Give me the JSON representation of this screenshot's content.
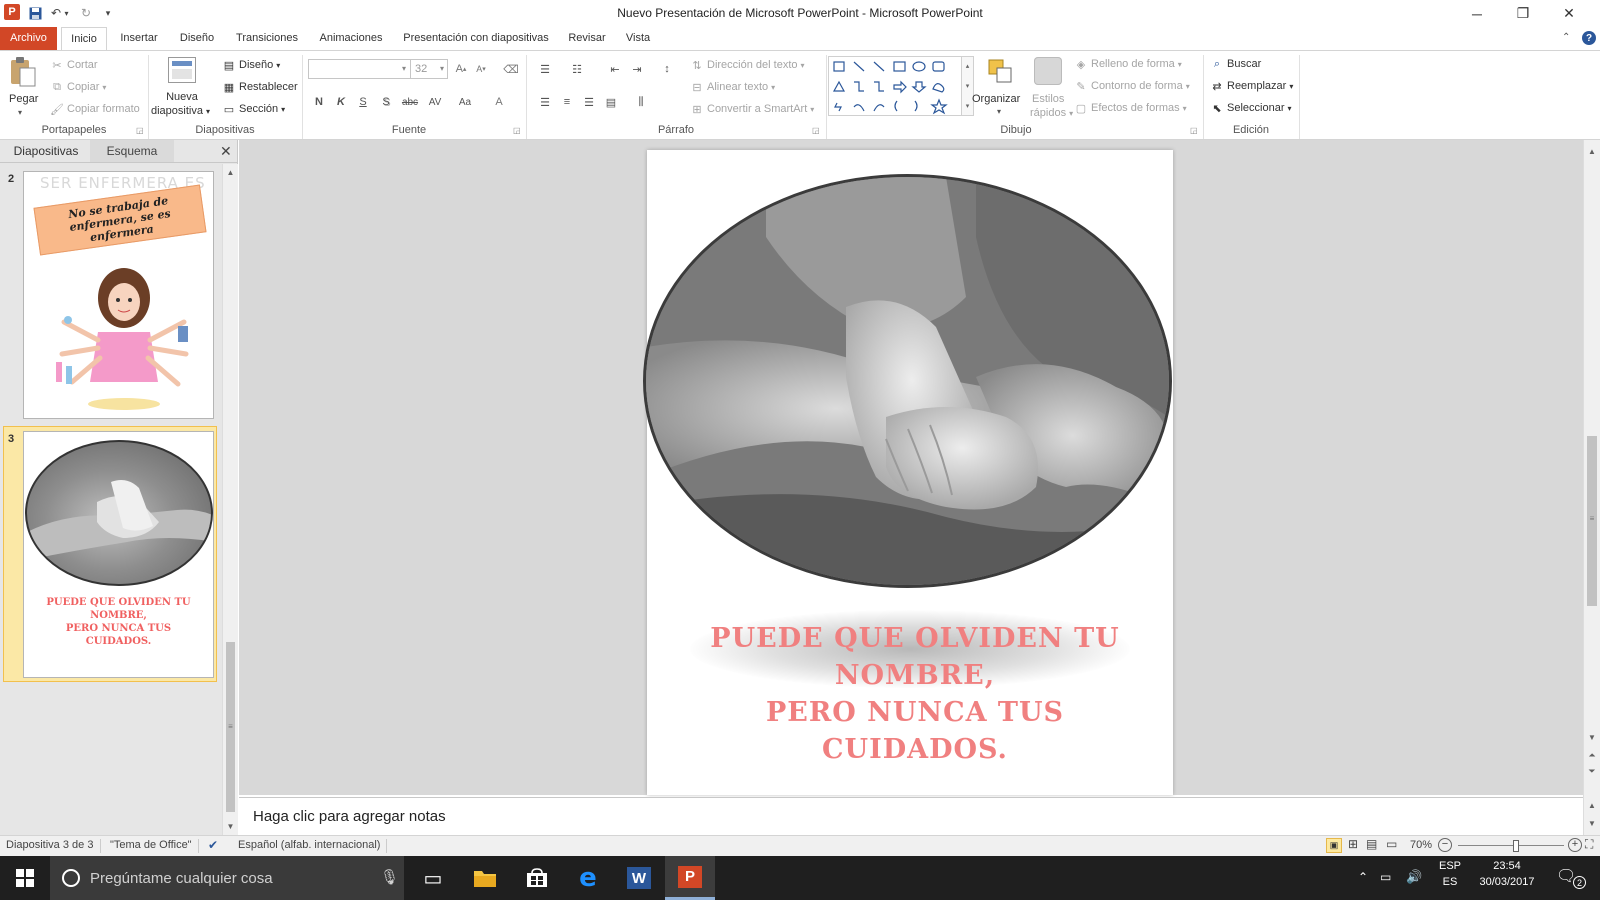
{
  "window": {
    "title": "Nuevo Presentación de Microsoft PowerPoint - Microsoft PowerPoint"
  },
  "tabs": [
    {
      "label": "Archivo"
    },
    {
      "label": "Inicio"
    },
    {
      "label": "Insertar"
    },
    {
      "label": "Diseño"
    },
    {
      "label": "Transiciones"
    },
    {
      "label": "Animaciones"
    },
    {
      "label": "Presentación con diapositivas"
    },
    {
      "label": "Revisar"
    },
    {
      "label": "Vista"
    }
  ],
  "ribbon": {
    "portapapeles": {
      "label": "Portapapeles",
      "pegar": "Pegar",
      "cortar": "Cortar",
      "copiar": "Copiar",
      "copiar_formato": "Copiar formato"
    },
    "diapositivas": {
      "label": "Diapositivas",
      "nueva_l1": "Nueva",
      "nueva_l2": "diapositiva",
      "diseno": "Diseño",
      "restablecer": "Restablecer",
      "seccion": "Sección"
    },
    "fuente": {
      "label": "Fuente",
      "size": "32",
      "bold": "N",
      "italic": "K",
      "underline": "S",
      "shadow": "S",
      "strike": "abc",
      "spacing": "AV",
      "case": "Aa",
      "color": "A"
    },
    "parrafo": {
      "label": "Párrafo",
      "direccion": "Dirección del texto",
      "alinear": "Alinear texto",
      "smartart": "Convertir a SmartArt"
    },
    "dibujo": {
      "label": "Dibujo",
      "organizar": "Organizar",
      "estilos_l1": "Estilos",
      "estilos_l2": "rápidos",
      "relleno": "Relleno de forma",
      "contorno": "Contorno de forma",
      "efectos": "Efectos de formas"
    },
    "edicion": {
      "label": "Edición",
      "buscar": "Buscar",
      "reemplazar": "Reemplazar",
      "seleccionar": "Seleccionar"
    }
  },
  "left_pane": {
    "tab_diapositivas": "Diapositivas",
    "tab_esquema": "Esquema",
    "thumbs": [
      {
        "number": "2",
        "header": "SER ENFERMERA ES",
        "banner": "No se trabaja de enfermera, se es enfermera"
      },
      {
        "number": "3",
        "caption_l1": "PUEDE QUE OLVIDEN TU",
        "caption_l2": "NOMBRE,",
        "caption_l3": "PERO NUNCA TUS",
        "caption_l4": "CUIDADOS."
      }
    ]
  },
  "slide": {
    "line1": "PUEDE QUE OLVIDEN TU",
    "line2": "NOMBRE,",
    "line3": "PERO NUNCA TUS",
    "line4": "CUIDADOS."
  },
  "notes": {
    "placeholder": "Haga clic para agregar notas"
  },
  "status": {
    "slide_count": "Diapositiva 3 de 3",
    "theme": "\"Tema de Office\"",
    "language": "Español (alfab. internacional)",
    "zoom": "70%",
    "zoom_level": 0.55
  },
  "taskbar": {
    "search_placeholder": "Pregúntame cualquier cosa",
    "lang_top": "ESP",
    "lang_bottom": "ES",
    "time": "23:54",
    "date": "30/03/2017",
    "notif_count": "2"
  },
  "colors": {
    "archivo_tab": "#d24726",
    "slide_text": "#f08080",
    "thumb_selected_bg": "#fbe8a6",
    "taskbar_bg": "#1f1f1f"
  }
}
